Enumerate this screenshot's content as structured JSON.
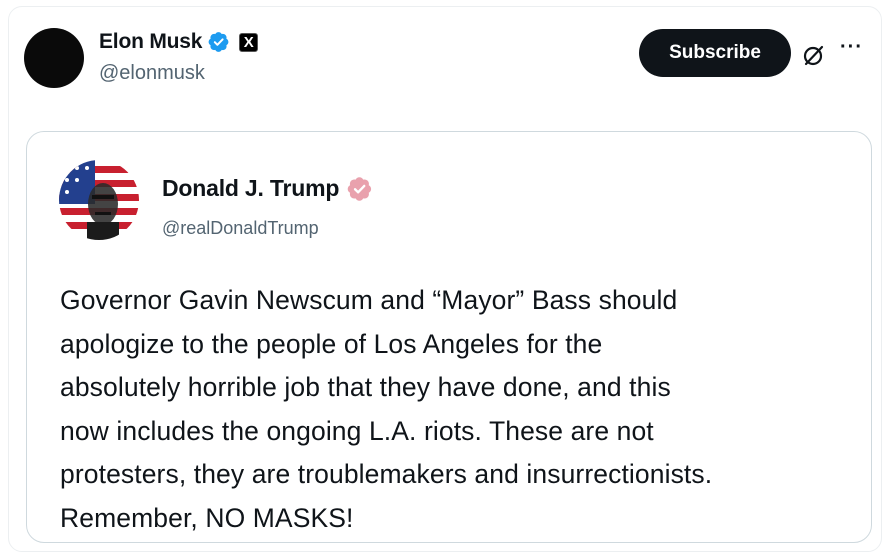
{
  "post": {
    "author_name": "Elon Musk",
    "author_handle": "@elonmusk",
    "affiliate_badge": "X",
    "subscribe_label": "Subscribe",
    "more_label": "···"
  },
  "quoted": {
    "author_name": "Donald J. Trump",
    "author_handle": "@realDonaldTrump",
    "text_lines": [
      "Governor Gavin Newscum and “Mayor” Bass should",
      "apologize to the people of Los Angeles for the",
      "absolutely horrible job that they have done, and this",
      "now includes the ongoing L.A. riots. These are not",
      "protesters, they are troublemakers and insurrectionists.",
      "Remember, NO MASKS!"
    ]
  },
  "icons": {
    "verified_blue": "verified-badge-icon",
    "verified_gold": "verified-badge-icon",
    "grok": "grok-icon",
    "more": "more-icon"
  },
  "colors": {
    "verified_blue": "#1d9bf0",
    "verified_gold": "#e9a1ad",
    "subscribe_bg": "#0f1419"
  }
}
